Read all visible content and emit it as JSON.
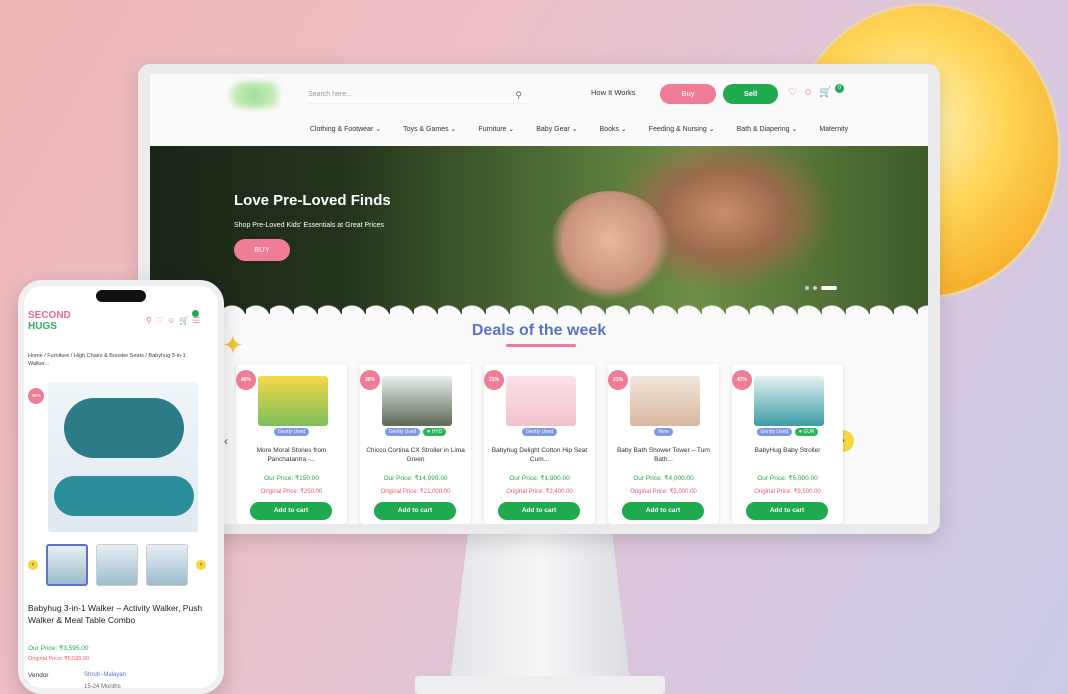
{
  "header": {
    "search_placeholder": "Search here...",
    "how_it_works": "How It Works",
    "buy_label": "Buy",
    "sell_label": "Sell",
    "cart_count": "0"
  },
  "nav": [
    "Clothing & Footwear ⌄",
    "Toys & Games ⌄",
    "Furniture ⌄",
    "Baby Gear ⌄",
    "Books ⌄",
    "Feeding & Nursing ⌄",
    "Bath & Diapering ⌄",
    "Maternity"
  ],
  "hero": {
    "title": "Love Pre-Loved Finds",
    "subtitle": "Shop Pre-Loved Kids' Essentials at Great Prices",
    "button": "BUY"
  },
  "deals": {
    "heading": "Deals of the week",
    "cards": [
      {
        "off": "40% OFF",
        "tags": [
          "Gently Used"
        ],
        "name": "More Moral Stories from Panchatantra -...",
        "our_price": "Our Price: ₹150.00",
        "orig_price": "Original Price: ₹250.00",
        "button": "Add to cart"
      },
      {
        "off": "30% OFF",
        "tags": [
          "Gently Used",
          "♥ HYD"
        ],
        "name": "Chicco Cortina CX Stroller in Lima Green",
        "our_price": "Our Price: ₹14,999.00",
        "orig_price": "Original Price: ₹21,000.00",
        "button": "Add to cart"
      },
      {
        "off": "21% OFF",
        "tags": [
          "Gently Used"
        ],
        "name": "Babyhug Delight Cotton Hip Seat Cum...",
        "our_price": "Our Price: ₹1,900.00",
        "orig_price": "Original Price: ₹2,400.00",
        "button": "Add to cart"
      },
      {
        "off": "21% OFF",
        "tags": [
          "New"
        ],
        "name": "Baby Bath Shower Tower – Turn Bath...",
        "our_price": "Our Price: ₹4,000.00",
        "orig_price": "Original Price: ₹5,000.00",
        "button": "Add to cart"
      },
      {
        "off": "47% OFF",
        "tags": [
          "Gently Used",
          "♥ GUR"
        ],
        "name": "BabyHug Baby Stroller",
        "our_price": "Our Price: ₹5,000.00",
        "orig_price": "Original Price: ₹9,500.00",
        "button": "Add to cart"
      }
    ]
  },
  "phone": {
    "logo_top": "SECOND",
    "logo_bottom": "HUGS",
    "breadcrumb": "Home / Furniture / High Chairs & Booster Seats / Babyhug 3-in-1 Walker...",
    "off": "38% OFF",
    "title": "Babyhug 3-in-1 Walker – Activity Walker, Push Walker & Meal Table Combo",
    "our_price": "Our Price: ₹3,595.00",
    "orig_price": "Original Price: ₹5,595.00",
    "vendor_label": "Vendor",
    "vendor_value": "Shruti -Malayan",
    "more": "15-24 Months"
  },
  "colors": {
    "pink": "#f07d97",
    "green": "#1faa50",
    "blue": "#5b73c6",
    "yellow": "#f7d640"
  }
}
